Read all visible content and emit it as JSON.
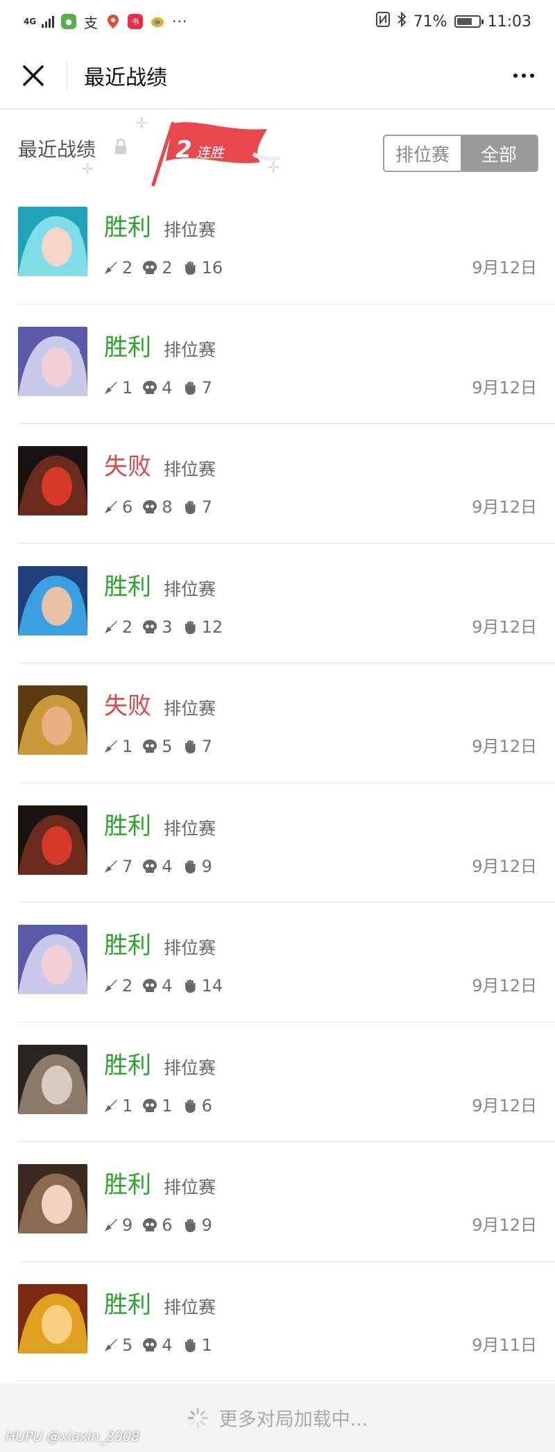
{
  "status_bar": {
    "network": "4G",
    "battery": "71%",
    "battery_level": 0.71,
    "time": "11:03",
    "app_icons": [
      "wechat-icon",
      "alipay-icon",
      "maps-icon",
      "xiaohongshu-icon",
      "weibo-icon"
    ],
    "more": "···"
  },
  "title_bar": {
    "title": "最近战绩"
  },
  "header": {
    "section_title": "最近战绩",
    "streak_number": "2",
    "streak_text": "连胜",
    "tabs": [
      {
        "label": "排位赛",
        "active": false
      },
      {
        "label": "全部",
        "active": true
      }
    ]
  },
  "matches": [
    {
      "result": "胜利",
      "outcome": "win",
      "mode": "排位赛",
      "kills": "2",
      "deaths": "2",
      "assists": "16",
      "date": "9月12日",
      "hero_colors": [
        "#1ea3b8",
        "#7fdde8",
        "#f3d6c8"
      ]
    },
    {
      "result": "胜利",
      "outcome": "win",
      "mode": "排位赛",
      "kills": "1",
      "deaths": "4",
      "assists": "7",
      "date": "9月12日",
      "hero_colors": [
        "#5a5aa8",
        "#c9c9ea",
        "#f0d0d4"
      ]
    },
    {
      "result": "失败",
      "outcome": "loss",
      "mode": "排位赛",
      "kills": "6",
      "deaths": "8",
      "assists": "7",
      "date": "9月12日",
      "hero_colors": [
        "#1a1210",
        "#6b2b1c",
        "#d4392a"
      ]
    },
    {
      "result": "胜利",
      "outcome": "win",
      "mode": "排位赛",
      "kills": "2",
      "deaths": "3",
      "assists": "12",
      "date": "9月12日",
      "hero_colors": [
        "#1f3f7a",
        "#3aa0e0",
        "#e8c0a8"
      ]
    },
    {
      "result": "失败",
      "outcome": "loss",
      "mode": "排位赛",
      "kills": "1",
      "deaths": "5",
      "assists": "7",
      "date": "9月12日",
      "hero_colors": [
        "#5a3a10",
        "#c89a3a",
        "#e8b080"
      ]
    },
    {
      "result": "胜利",
      "outcome": "win",
      "mode": "排位赛",
      "kills": "7",
      "deaths": "4",
      "assists": "9",
      "date": "9月12日",
      "hero_colors": [
        "#1a1210",
        "#6b2b1c",
        "#d4392a"
      ]
    },
    {
      "result": "胜利",
      "outcome": "win",
      "mode": "排位赛",
      "kills": "2",
      "deaths": "4",
      "assists": "14",
      "date": "9月12日",
      "hero_colors": [
        "#5a5aa8",
        "#c9c9ea",
        "#f0d0d4"
      ]
    },
    {
      "result": "胜利",
      "outcome": "win",
      "mode": "排位赛",
      "kills": "1",
      "deaths": "1",
      "assists": "6",
      "date": "9月12日",
      "hero_colors": [
        "#2a2420",
        "#8a7a6a",
        "#d8ccc0"
      ]
    },
    {
      "result": "胜利",
      "outcome": "win",
      "mode": "排位赛",
      "kills": "9",
      "deaths": "6",
      "assists": "9",
      "date": "9月12日",
      "hero_colors": [
        "#3a2a20",
        "#8a6a50",
        "#f0d4c0"
      ]
    },
    {
      "result": "胜利",
      "outcome": "win",
      "mode": "排位赛",
      "kills": "5",
      "deaths": "4",
      "assists": "1",
      "date": "9月11日",
      "hero_colors": [
        "#7a2a10",
        "#e0a020",
        "#f8d080"
      ]
    }
  ],
  "footer": {
    "load_more": "更多对局加载中..."
  },
  "watermark": "HUPU @xiaxin_2008",
  "colors": {
    "win": "#2aa52a",
    "loss": "#e04848",
    "flag": "#e8474d"
  }
}
